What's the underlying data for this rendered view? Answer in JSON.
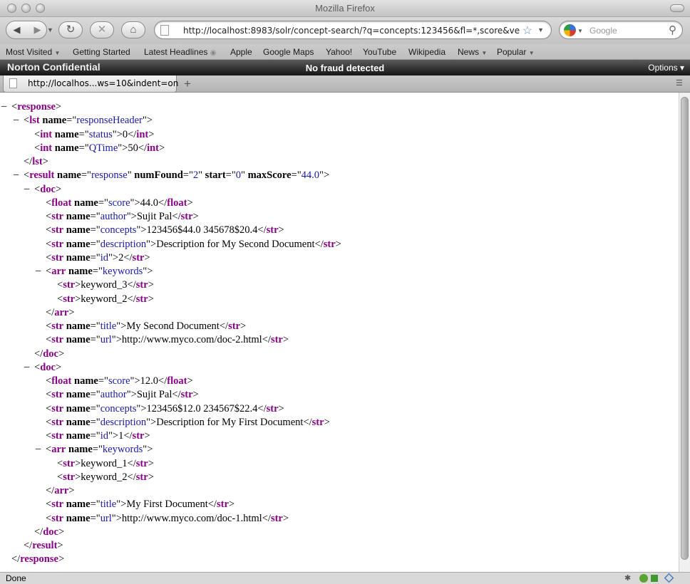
{
  "window": {
    "title": "Mozilla Firefox"
  },
  "navbar": {
    "url": "http://localhost:8983/solr/concept-search/?q=concepts:123456&fl=*,score&ve",
    "search_placeholder": "Google"
  },
  "bookmarks": [
    "Most Visited",
    "Getting Started",
    "Latest Headlines",
    "Apple",
    "Google Maps",
    "Yahoo!",
    "YouTube",
    "Wikipedia",
    "News",
    "Popular"
  ],
  "norton": {
    "logo": "Norton Confidential",
    "status": "No fraud detected",
    "options": "Options"
  },
  "tab": {
    "label": "http://localhos...ws=10&indent=on"
  },
  "status": {
    "text": "Done"
  },
  "xml": {
    "l1": [
      "response"
    ],
    "l2": [
      "lst",
      "name",
      "responseHeader"
    ],
    "l3": [
      "int",
      "name",
      "status",
      "0"
    ],
    "l4": [
      "int",
      "name",
      "QTime",
      "50"
    ],
    "l5": [
      "lst"
    ],
    "l6": [
      "result",
      "name",
      "response",
      "numFound",
      "2",
      "start",
      "0",
      "maxScore",
      "44.0"
    ],
    "l7": [
      "doc"
    ],
    "l8": [
      "float",
      "name",
      "score",
      "44.0"
    ],
    "l9": [
      "str",
      "name",
      "author",
      "Sujit Pal"
    ],
    "l10": [
      "str",
      "name",
      "concepts",
      "123456$44.0 345678$20.4"
    ],
    "l11": [
      "str",
      "name",
      "description",
      "Description for My Second Document"
    ],
    "l12": [
      "str",
      "name",
      "id",
      "2"
    ],
    "l13": [
      "arr",
      "name",
      "keywords"
    ],
    "l14": [
      "str",
      "keyword_3"
    ],
    "l15": [
      "str",
      "keyword_2"
    ],
    "l16": [
      "arr"
    ],
    "l17": [
      "str",
      "name",
      "title",
      "My Second Document"
    ],
    "l18": [
      "str",
      "name",
      "url",
      "http://www.myco.com/doc-2.html"
    ],
    "l19": [
      "doc"
    ],
    "l20": [
      "doc"
    ],
    "l21": [
      "float",
      "name",
      "score",
      "12.0"
    ],
    "l22": [
      "str",
      "name",
      "author",
      "Sujit Pal"
    ],
    "l23": [
      "str",
      "name",
      "concepts",
      "123456$12.0 234567$22.4"
    ],
    "l24": [
      "str",
      "name",
      "description",
      "Description for My First Document"
    ],
    "l25": [
      "str",
      "name",
      "id",
      "1"
    ],
    "l26": [
      "arr",
      "name",
      "keywords"
    ],
    "l27": [
      "str",
      "keyword_1"
    ],
    "l28": [
      "str",
      "keyword_2"
    ],
    "l29": [
      "arr"
    ],
    "l30": [
      "str",
      "name",
      "title",
      "My First Document"
    ],
    "l31": [
      "str",
      "name",
      "url",
      "http://www.myco.com/doc-1.html"
    ],
    "l32": [
      "doc"
    ],
    "l33": [
      "result"
    ],
    "l34": [
      "response"
    ]
  }
}
